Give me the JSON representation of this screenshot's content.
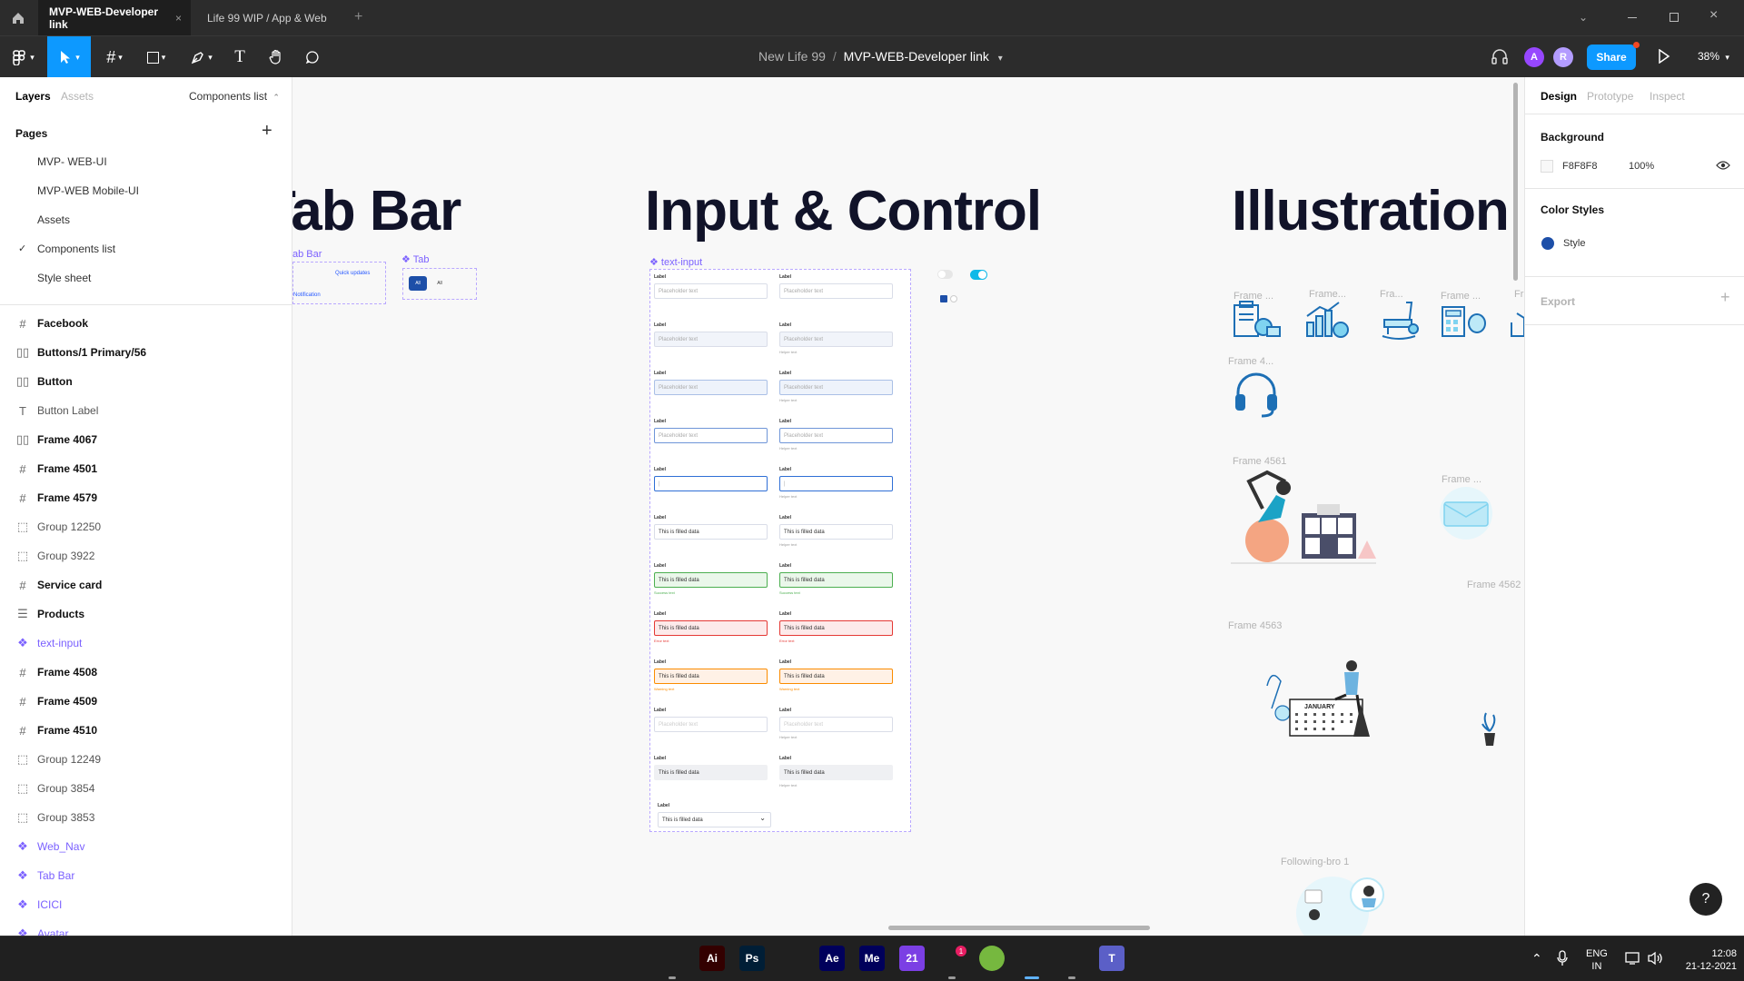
{
  "titlebar": {
    "home_icon": "home-icon",
    "tabs": [
      {
        "label": "MVP-WEB-Developer link",
        "active": true
      },
      {
        "label": "Life 99 WIP / App & Web",
        "active": false
      }
    ],
    "new_tab": "+"
  },
  "toolbar": {
    "breadcrumb_project": "New Life 99",
    "breadcrumb_sep": "/",
    "breadcrumb_file": "MVP-WEB-Developer link",
    "avatars": [
      {
        "letter": "A",
        "color": "#9747ff"
      },
      {
        "letter": "R",
        "color": "#b39cff"
      }
    ],
    "share_label": "Share",
    "zoom": "38%"
  },
  "left_panel": {
    "tabs": [
      "Layers",
      "Assets"
    ],
    "components_list": "Components list",
    "pages_title": "Pages",
    "pages": [
      {
        "label": "MVP- WEB-UI",
        "checked": false
      },
      {
        "label": "MVP-WEB Mobile-UI",
        "checked": false
      },
      {
        "label": "Assets",
        "checked": false
      },
      {
        "label": "Components list",
        "checked": true
      },
      {
        "label": "Style sheet",
        "checked": false
      }
    ],
    "layers": [
      {
        "label": "Facebook",
        "kind": "frame",
        "icon": "#"
      },
      {
        "label": "Buttons/1 Primary/56",
        "kind": "frame",
        "icon": "▯▯"
      },
      {
        "label": "Button",
        "kind": "frame",
        "icon": "▯▯"
      },
      {
        "label": "Button Label",
        "kind": "text",
        "icon": "T"
      },
      {
        "label": "Frame 4067",
        "kind": "frame",
        "icon": "▯▯"
      },
      {
        "label": "Frame 4501",
        "kind": "frame",
        "icon": "#"
      },
      {
        "label": "Frame 4579",
        "kind": "frame",
        "icon": "#"
      },
      {
        "label": "Group 12250",
        "kind": "group",
        "icon": "⬚"
      },
      {
        "label": "Group 3922",
        "kind": "group",
        "icon": "⬚"
      },
      {
        "label": "Service card",
        "kind": "frame",
        "icon": "#"
      },
      {
        "label": "Products",
        "kind": "frame",
        "icon": "☰"
      },
      {
        "label": "text-input",
        "kind": "component",
        "icon": "❖"
      },
      {
        "label": "Frame 4508",
        "kind": "frame",
        "icon": "#"
      },
      {
        "label": "Frame 4509",
        "kind": "frame",
        "icon": "#"
      },
      {
        "label": "Frame 4510",
        "kind": "frame",
        "icon": "#"
      },
      {
        "label": "Group 12249",
        "kind": "group",
        "icon": "⬚"
      },
      {
        "label": "Group 3854",
        "kind": "group",
        "icon": "⬚"
      },
      {
        "label": "Group 3853",
        "kind": "group",
        "icon": "⬚"
      },
      {
        "label": "Web_Nav",
        "kind": "component",
        "icon": "❖"
      },
      {
        "label": "Tab Bar",
        "kind": "component",
        "icon": "❖"
      },
      {
        "label": "ICICI",
        "kind": "component",
        "icon": "❖"
      },
      {
        "label": "Avatar",
        "kind": "component",
        "icon": "❖"
      }
    ]
  },
  "canvas": {
    "titles": [
      "Tab Bar",
      "Input & Control",
      "Illustration"
    ],
    "tabbar_label": "ab Bar",
    "tab_label": "Tab",
    "quick_updates": "Quick updates",
    "notification": "Notification",
    "tab_all": "All",
    "text_input_label": "text-input",
    "form": {
      "label": "Label",
      "placeholder": "Placeholder text",
      "helper": "Helper text",
      "filled": "This is filled data",
      "success": "Success text",
      "error": "Error text",
      "warning": "Warning text",
      "cursor": "|"
    },
    "frame_labels": [
      "Frame ...",
      "Frame...",
      "Fra...",
      "Frame ...",
      "Fr",
      "Frame 4...",
      "Frame 4561",
      "Frame ...",
      "Frame 4562",
      "Frame 4563",
      "Following-bro 1"
    ],
    "calendar_month": "JANUARY"
  },
  "right_panel": {
    "tabs": [
      "Design",
      "Prototype",
      "Inspect"
    ],
    "background_title": "Background",
    "bg_color": "F8F8F8",
    "bg_opacity": "100%",
    "color_styles_title": "Color Styles",
    "style_label": "Style",
    "style_color": "#1d4fa8",
    "export_title": "Export"
  },
  "help_button": "?",
  "taskbar": {
    "apps": [
      {
        "name": "start-icon",
        "label": "",
        "bg": "#1e88e5"
      },
      {
        "name": "search-icon",
        "label": "",
        "bg": "transparent"
      },
      {
        "name": "file-explorer-icon",
        "label": "",
        "bg": "#f4c542"
      },
      {
        "name": "illustrator-icon",
        "label": "Ai",
        "bg": "#330000"
      },
      {
        "name": "photoshop-icon",
        "label": "Ps",
        "bg": "#001e36"
      },
      {
        "name": "brave-icon",
        "label": "",
        "bg": "transparent"
      },
      {
        "name": "after-effects-icon",
        "label": "Ae",
        "bg": "#00005b"
      },
      {
        "name": "media-encoder-icon",
        "label": "Me",
        "bg": "#00005b"
      },
      {
        "name": "app-21-icon",
        "label": "21",
        "bg": "#7b3fe4"
      },
      {
        "name": "slack-icon",
        "label": "",
        "bg": "transparent"
      },
      {
        "name": "utorrent-icon",
        "label": "",
        "bg": "#76b83f"
      },
      {
        "name": "figma-icon",
        "label": "",
        "bg": "transparent"
      },
      {
        "name": "chrome-icon",
        "label": "",
        "bg": "transparent"
      },
      {
        "name": "teams-icon",
        "label": "T",
        "bg": "#5b5fc7"
      },
      {
        "name": "steam-icon",
        "label": "",
        "bg": "transparent"
      }
    ],
    "slack_badge": "1",
    "lang_top": "ENG",
    "lang_bottom": "IN",
    "time": "12:08",
    "date": "21-12-2021"
  }
}
